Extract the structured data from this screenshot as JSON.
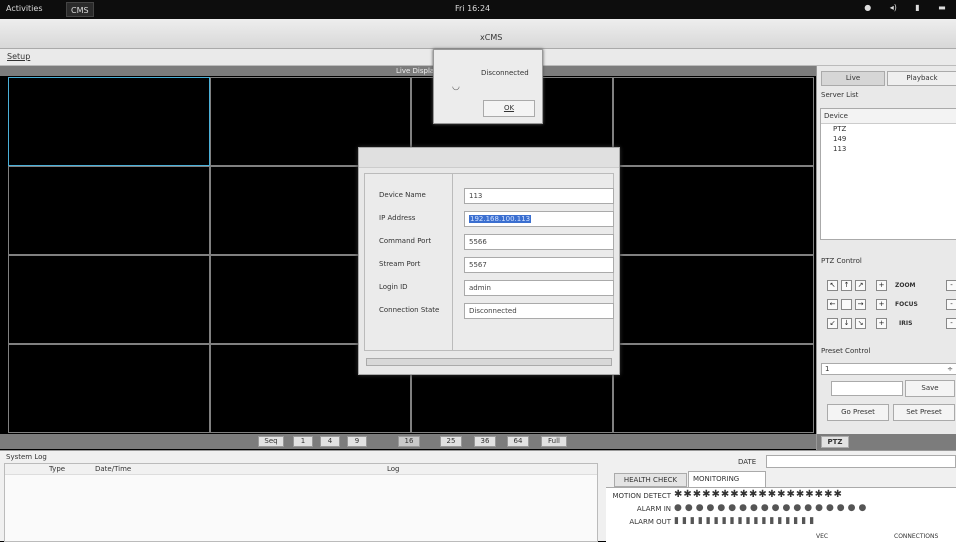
{
  "topbar": {
    "activities": "Activities",
    "app": "CMS",
    "clock": "Fri 16:24"
  },
  "window": {
    "title": "xCMS"
  },
  "menu": {
    "setup": "Setup"
  },
  "live": {
    "title": "Live Display"
  },
  "seq": {
    "buttons": [
      "Seq",
      "1",
      "4",
      "9",
      "16",
      "25",
      "36",
      "64",
      "Full"
    ]
  },
  "panel": {
    "tabs": [
      "Live",
      "Playback"
    ],
    "server_list": "Server List",
    "device_label": "Device",
    "devices": [
      "PTZ",
      "149",
      "113"
    ],
    "ptz_control": "PTZ Control",
    "zoom": "ZOOM",
    "focus": "FOCUS",
    "iris": "IRIS",
    "preset_control": "Preset Control",
    "preset_value": "1",
    "save": "Save",
    "go_preset": "Go Preset",
    "set_preset": "Set Preset",
    "ptz_tab": "PTZ"
  },
  "system_log": {
    "title": "System Log",
    "columns": [
      "Type",
      "Date/Time",
      "Log"
    ]
  },
  "monitor": {
    "date_label": "DATE",
    "tabs": [
      "HEALTH CHECK",
      "MONITORING"
    ],
    "rows": [
      "MOTION DETECT",
      "ALARM IN",
      "ALARM OUT"
    ],
    "bottom_left": "VEC",
    "bottom_right": "CONNECTIONS"
  },
  "alert": {
    "message": "Disconnected",
    "ok": "OK"
  },
  "device_dialog": {
    "fields": [
      {
        "label": "Device Name",
        "value": "113"
      },
      {
        "label": "IP Address",
        "value": "192.168.100.113"
      },
      {
        "label": "Command Port",
        "value": "5566"
      },
      {
        "label": "Stream Port",
        "value": "5567"
      },
      {
        "label": "Login ID",
        "value": "admin"
      },
      {
        "label": "Connection State",
        "value": "Disconnected"
      }
    ]
  }
}
